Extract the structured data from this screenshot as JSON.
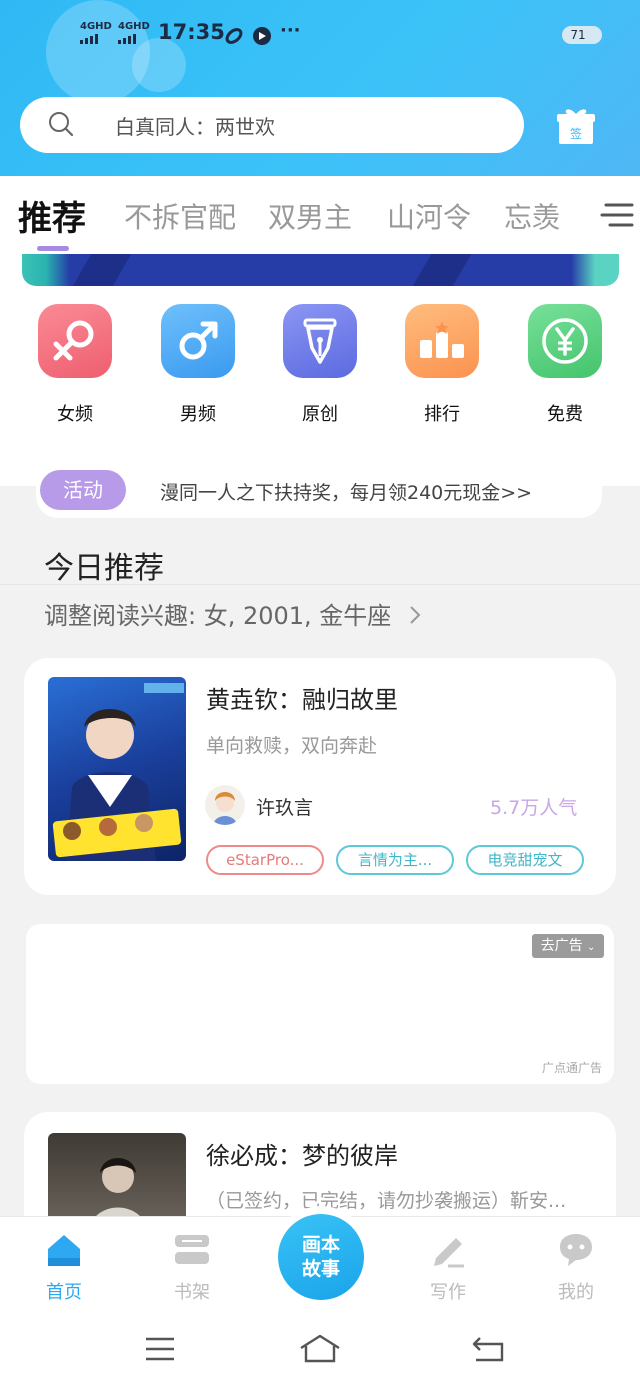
{
  "status_bar": {
    "signal_1": "4GHD",
    "signal_2": "4GHD",
    "time": "17:35",
    "more": "···",
    "battery": "71",
    "battery_level": 0.71
  },
  "search": {
    "placeholder": "白真同人：两世欢"
  },
  "gift_label": "签",
  "tabs": [
    {
      "label": "推荐",
      "active": true
    },
    {
      "label": "不拆官配"
    },
    {
      "label": "双男主"
    },
    {
      "label": "山河令"
    },
    {
      "label": "忘羡"
    }
  ],
  "categories": [
    {
      "label": "女频",
      "icon": "female-symbol-icon",
      "color": "#f26f7d"
    },
    {
      "label": "男频",
      "icon": "male-symbol-icon",
      "color": "#4aa6f2"
    },
    {
      "label": "原创",
      "icon": "fountain-pen-icon",
      "color": "#6f7de8"
    },
    {
      "label": "排行",
      "icon": "podium-icon",
      "color": "#fda25a"
    },
    {
      "label": "免费",
      "icon": "yen-coin-icon",
      "color": "#52cd7a"
    }
  ],
  "activity": {
    "badge": "活动",
    "text": "漫同一人之下扶持奖，每月领240元现金>>"
  },
  "today": {
    "title": "今日推荐",
    "interest": "调整阅读兴趣: 女, 2001, 金牛座"
  },
  "books": [
    {
      "title": "黄垚钦：融归故里",
      "subtitle": "单向救赎，双向奔赴",
      "author": "许玖言",
      "popularity": "5.7万人气",
      "tags": [
        "eStarPro...",
        "言情为主...",
        "电竞甜宠文"
      ]
    },
    {
      "title": "徐必成：梦的彼岸",
      "subtitle": "（已签约，已完结，请勿抄袭搬运）靳安..."
    }
  ],
  "ad": {
    "close_label": "去广告",
    "source": "广点通广告"
  },
  "bottom_nav": {
    "items": [
      {
        "label": "首页",
        "icon": "home-icon",
        "active": true
      },
      {
        "label": "书架",
        "icon": "bookshelf-icon"
      },
      {
        "label": "写作",
        "icon": "pencil-icon"
      },
      {
        "label": "我的",
        "icon": "chat-bubble-icon"
      }
    ],
    "center_line1": "画本",
    "center_line2": "故事"
  },
  "colors": {
    "header": "#34bdf6",
    "accent_purple": "#a78be0",
    "nav_active": "#2ea8f0"
  }
}
